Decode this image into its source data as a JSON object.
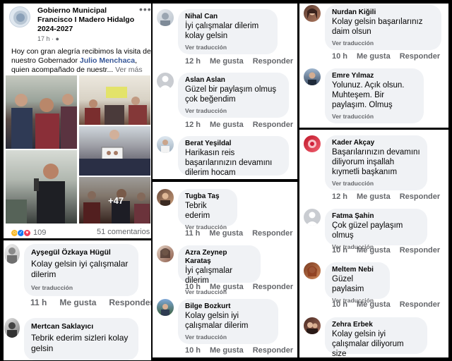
{
  "post": {
    "page_name": "Gobierno Municipal Francisco I Madero Hidalgo 2024-2027",
    "time": "17 h",
    "menu": "•••",
    "text_before": "Hoy con gran alegría recibimos la visita de nuestro Gobernador ",
    "link": "Julio Menchaca",
    "text_after": ", quien acompañado de nuestr... ",
    "see_more": "Ver más",
    "more_photos": "+47",
    "reactions_count": "109",
    "comments_count": "51 comentarios"
  },
  "labels": {
    "translate": "Ver traducción",
    "like": "Me gusta",
    "reply": "Responder"
  },
  "colors": {
    "link": "#385898",
    "meta": "#65676b",
    "bubble": "#f0f2f5",
    "like": "#1877f2",
    "love": "#f33e58"
  },
  "comments": [
    {
      "name": "Ayşegül Özkaya Hügül",
      "text": "Kolay gelsin iyi çalışmalar dilerim",
      "time": "11 h"
    },
    {
      "name": "Mertcan Saklayıcı",
      "text": "Tebrik ederim sizleri kolay gelsin",
      "time": ""
    },
    {
      "name": "Nihal Can",
      "text": "İyi çalışmalar dilerim kolay gelsin",
      "time": "12 h"
    },
    {
      "name": "Aslan Aslan",
      "text": "Güzel bir paylaşım olmuş çok beğendim",
      "time": "12 h"
    },
    {
      "name": "Berat Yeşildal",
      "text": "Harikasın reis başarılarınızın devamını dilerim hocam",
      "time": ""
    },
    {
      "name": "Tugba Taş",
      "text": "Tebrik ederim",
      "time": "11 h"
    },
    {
      "name": "Azra Zeynep Karataş",
      "text": "İyi çalışmalar dilerim",
      "time": "10 h"
    },
    {
      "name": "Bilge Bozkurt",
      "text": "Kolay gelsin iyi çalışmalar dilerim",
      "time": "10 h"
    },
    {
      "name": "Nurdan Kiğili",
      "text": "Kolay gelsin başarılarınız daim olsun",
      "time": "10 h"
    },
    {
      "name": "Emre Yılmaz",
      "text": "Yolunuz. Açık olsun. Muhteşem. Bir paylaşım. Olmuş",
      "time": ""
    },
    {
      "name": "Kader Akçay",
      "text": "Başarılarınızın devamını diliyorum inşallah kıymetli başkanım",
      "time": "12 h"
    },
    {
      "name": "Fatma Şahin",
      "text": "Çok güzel paylaşım olmuş",
      "time": "10 h"
    },
    {
      "name": "Meltem Nebi",
      "text": "Güzel paylasim",
      "time": "10 h"
    },
    {
      "name": "Zehra Erbek",
      "text": "Kolay gelsin iyi çalışmalar diliyorum size",
      "time": ""
    }
  ]
}
